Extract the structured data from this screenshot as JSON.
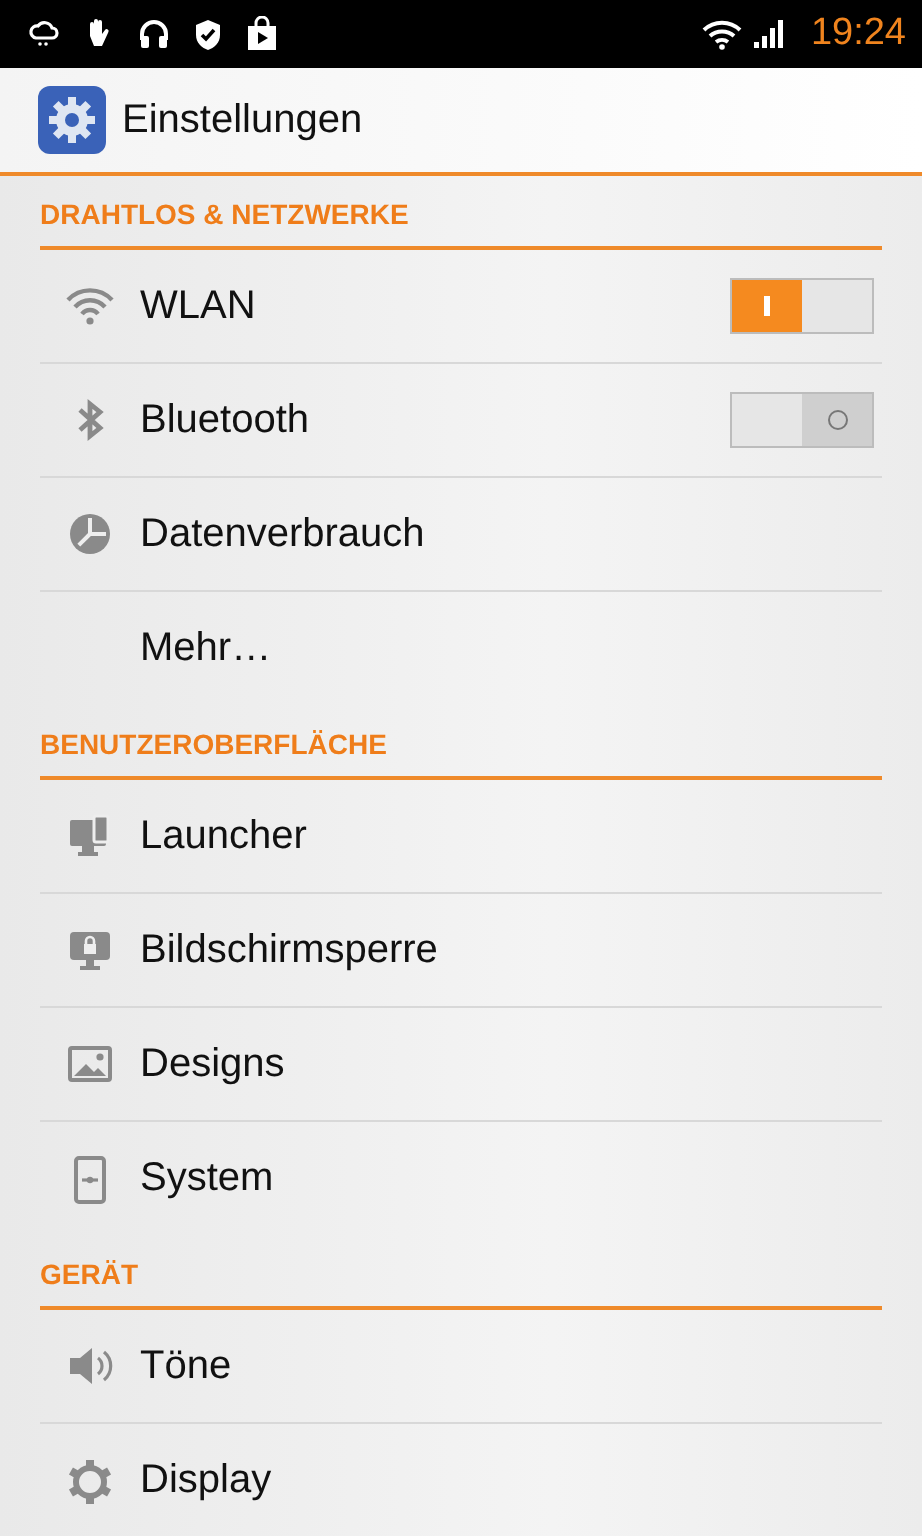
{
  "status_bar": {
    "time": "19:24"
  },
  "action_bar": {
    "title": "Einstellungen"
  },
  "sections": [
    {
      "header": "DRAHTLOS & NETZWERKE",
      "items": [
        {
          "label": "WLAN",
          "kind": "toggle",
          "on": true
        },
        {
          "label": "Bluetooth",
          "kind": "toggle",
          "on": false
        },
        {
          "label": "Datenverbrauch",
          "kind": "plain"
        },
        {
          "label": "Mehr…",
          "kind": "plain"
        }
      ]
    },
    {
      "header": "BENUTZEROBERFLÄCHE",
      "items": [
        {
          "label": "Launcher",
          "kind": "plain"
        },
        {
          "label": "Bildschirmsperre",
          "kind": "plain"
        },
        {
          "label": "Designs",
          "kind": "plain"
        },
        {
          "label": "System",
          "kind": "plain"
        }
      ]
    },
    {
      "header": "GERÄT",
      "items": [
        {
          "label": "Töne",
          "kind": "plain"
        },
        {
          "label": "Display",
          "kind": "plain"
        }
      ]
    }
  ]
}
